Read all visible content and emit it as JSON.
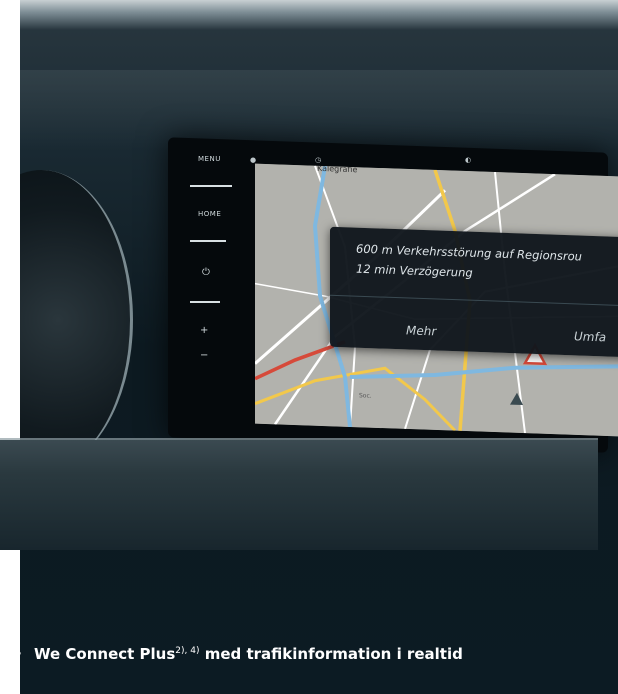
{
  "screen": {
    "sidebar": {
      "home_label": "HOME",
      "top_label": "MENU"
    },
    "map_labels": {
      "label_1": "Kalegrafie",
      "label_2": "Soc."
    },
    "alert": {
      "line1": "600 m Verkehrsstörung auf Regionsrou",
      "line2": "12 min Verzögerung",
      "more_button": "Mehr",
      "detour_button": "Umfa"
    }
  },
  "caption": {
    "bullet": "•",
    "product": "We Connect Plus",
    "footnotes": "2), 4)",
    "text": " med trafikinformation i realtid"
  },
  "colors": {
    "background": "#0e1a21",
    "caption_text": "#ffffff",
    "route_blue": "#7fb8e0",
    "road_yellow": "#f2c84b",
    "road_red": "#d64a3a"
  }
}
